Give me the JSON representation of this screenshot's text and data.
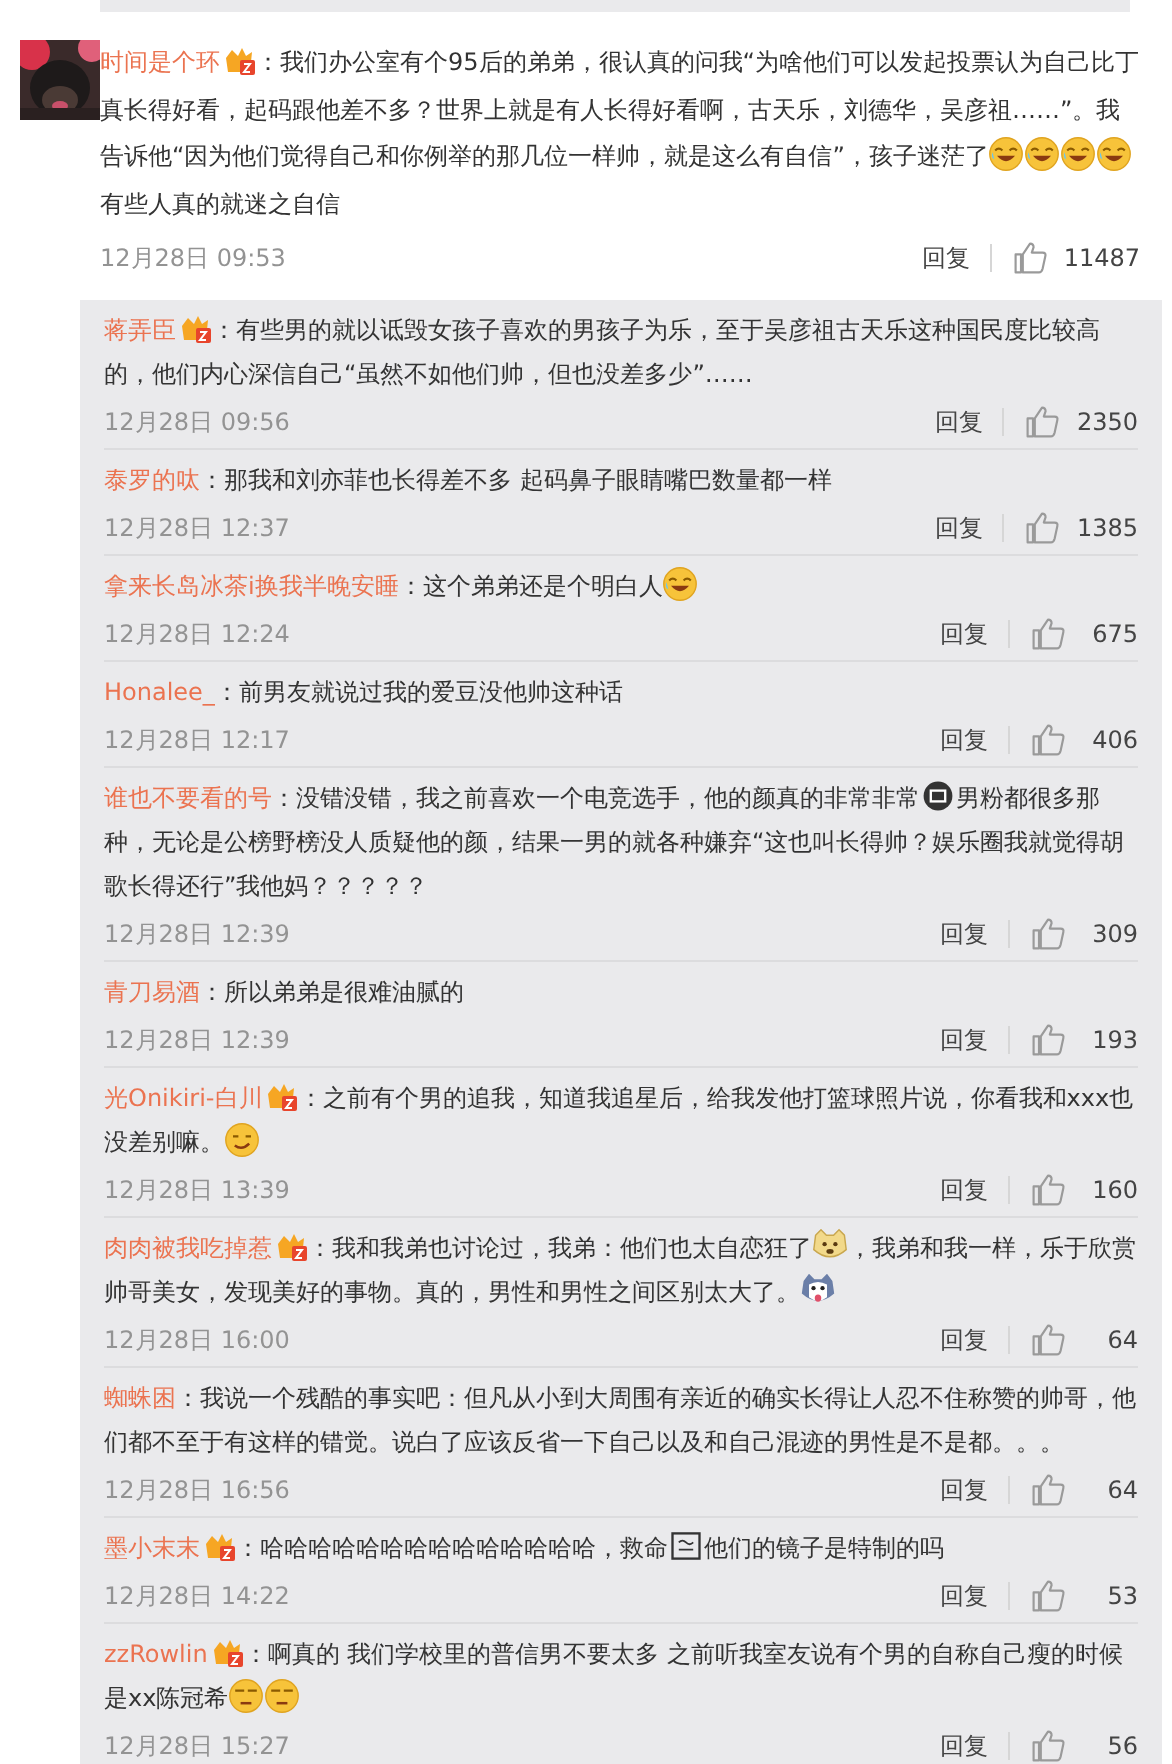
{
  "main_comment": {
    "user": "时间是个环",
    "vip": true,
    "parts": [
      {
        "kind": "text",
        "text": "：我们办公室有个95后的弟弟，很认真的问我“为啥他们可以发起投票认为自己比丁真长得好看，起码跟他差不多？世界上就是有人长得好看啊，古天乐，刘德华，吴彦祖……”。我告诉他“因为他们觉得自己和你例举的那几位一样帅，就是这么有自信”，孩子迷茫了"
      },
      {
        "kind": "laugh"
      },
      {
        "kind": "laugh"
      },
      {
        "kind": "laugh"
      },
      {
        "kind": "laugh"
      },
      {
        "kind": "text",
        "text": "有些人真的就迷之自信"
      }
    ],
    "date": "12月28日 09:53",
    "reply_label": "回复",
    "likes": "11487"
  },
  "replies": [
    {
      "user": "蒋弄臣",
      "vip": true,
      "parts": [
        {
          "kind": "text",
          "text": "：有些男的就以诋毁女孩子喜欢的男孩子为乐，至于吴彦祖古天乐这种国民度比较高的，他们内心深信自己“虽然不如他们帅，但也没差多少”……"
        }
      ],
      "date": "12月28日 09:56",
      "reply_label": "回复",
      "likes": "2350"
    },
    {
      "user": "泰罗的呔",
      "vip": false,
      "parts": [
        {
          "kind": "text",
          "text": "：那我和刘亦菲也长得差不多 起码鼻子眼睛嘴巴数量都一样"
        }
      ],
      "date": "12月28日 12:37",
      "reply_label": "回复",
      "likes": "1385"
    },
    {
      "user": "拿来长岛冰茶i换我半晚安睡",
      "vip": false,
      "parts": [
        {
          "kind": "text",
          "text": "：这个弟弟还是个明白人"
        },
        {
          "kind": "laugh"
        }
      ],
      "date": "12月28日 12:24",
      "reply_label": "回复",
      "likes": "675"
    },
    {
      "user": "Honalee_",
      "vip": false,
      "parts": [
        {
          "kind": "text",
          "text": "：前男友就说过我的爱豆没他帅这种话"
        }
      ],
      "date": "12月28日 12:17",
      "reply_label": "回复",
      "likes": "406"
    },
    {
      "user": "谁也不要看的号",
      "vip": false,
      "parts": [
        {
          "kind": "text",
          "text": "：没错没错，我之前喜欢一个电竞选手，他的颜真的非常非常"
        },
        {
          "kind": "dot"
        },
        {
          "kind": "text",
          "text": "男粉都很多那种，无论是公榜野榜没人质疑他的颜，结果一男的就各种嫌弃“这也叫长得帅？娱乐圈我就觉得胡歌长得还行”我他妈？？？？？"
        }
      ],
      "date": "12月28日 12:39",
      "reply_label": "回复",
      "likes": "309"
    },
    {
      "user": "青刀易酒",
      "vip": false,
      "parts": [
        {
          "kind": "text",
          "text": "：所以弟弟是很难油腻的"
        }
      ],
      "date": "12月28日 12:39",
      "reply_label": "回复",
      "likes": "193"
    },
    {
      "user": "光Onikiri-白川",
      "vip": true,
      "parts": [
        {
          "kind": "text",
          "text": "：之前有个男的追我，知道我追星后，给我发他打篮球照片说，你看我和xxx也没差别嘛。"
        },
        {
          "kind": "smug"
        }
      ],
      "date": "12月28日 13:39",
      "reply_label": "回复",
      "likes": "160"
    },
    {
      "user": "肉肉被我吃掉惹",
      "vip": true,
      "parts": [
        {
          "kind": "text",
          "text": "：我和我弟也讨论过，我弟：他们也太自恋狂了"
        },
        {
          "kind": "dog"
        },
        {
          "kind": "text",
          "text": "，我弟和我一样，乐于欣赏帅哥美女，发现美好的事物。真的，男性和男性之间区别太大了。"
        },
        {
          "kind": "husky"
        }
      ],
      "date": "12月28日 16:00",
      "reply_label": "回复",
      "likes": "64"
    },
    {
      "user": "蜘蛛困",
      "vip": false,
      "parts": [
        {
          "kind": "text",
          "text": "：我说一个残酷的事实吧：但凡从小到大周围有亲近的确实长得让人忍不住称赞的帅哥，他们都不至于有这样的错觉。说白了应该反省一下自己以及和自己混迹的男性是不是都。。。"
        }
      ],
      "date": "12月28日 16:56",
      "reply_label": "回复",
      "likes": "64"
    },
    {
      "user": "墨小末末",
      "vip": true,
      "parts": [
        {
          "kind": "text",
          "text": "：哈哈哈哈哈哈哈哈哈哈哈哈哈哈，救命"
        },
        {
          "kind": "box"
        },
        {
          "kind": "text",
          "text": "他们的镜子是特制的吗"
        }
      ],
      "date": "12月28日 14:22",
      "reply_label": "回复",
      "likes": "53"
    },
    {
      "user": "zzRowlin",
      "vip": true,
      "parts": [
        {
          "kind": "text",
          "text": "：啊真的 我们学校里的普信男不要太多 之前听我室友说有个男的自称自己瘦的时候是xx陈冠希"
        },
        {
          "kind": "meh"
        },
        {
          "kind": "meh"
        }
      ],
      "date": "12月28日 15:27",
      "reply_label": "回复",
      "likes": "56"
    }
  ]
}
